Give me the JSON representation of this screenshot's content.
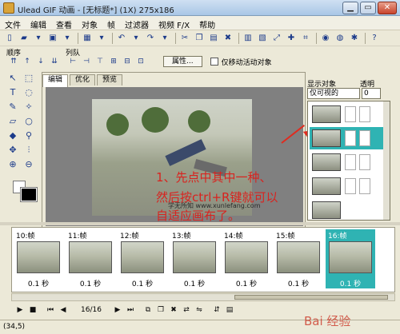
{
  "window": {
    "title": "Ulead GIF 动画 - [无标题*] (1X) 275x186",
    "minimize_label": "▁",
    "maximize_label": "▭",
    "close_label": "✕"
  },
  "menu": [
    "文件",
    "编辑",
    "查看",
    "对象",
    "帧",
    "过滤器",
    "视频 F/X",
    "帮助"
  ],
  "section_labels": {
    "order": "顺序",
    "arrange": "列队"
  },
  "row3": {
    "properties_button": "属性...",
    "checkbox_label": "仅移动活动对象"
  },
  "editor": {
    "tabs": [
      "编辑",
      "优化",
      "预览"
    ],
    "active_tab": 0
  },
  "annotation": {
    "line1": "1、先点中其中一种、",
    "line2": "然后按ctrl+R键就可以",
    "line3": "自适应画布了。",
    "site": "学无所知 www.xunlefang.com"
  },
  "object_panel": {
    "display_label": "显示对象",
    "opacity_label": "透明",
    "display_value": "仅可视的",
    "opacity_value": "0",
    "selected_index": 1
  },
  "frames": [
    {
      "label": "10:帧",
      "delay": "0.1 秒"
    },
    {
      "label": "11:帧",
      "delay": "0.1 秒"
    },
    {
      "label": "12:帧",
      "delay": "0.1 秒"
    },
    {
      "label": "13:帧",
      "delay": "0.1 秒"
    },
    {
      "label": "14:帧",
      "delay": "0.1 秒"
    },
    {
      "label": "15:帧",
      "delay": "0.1 秒"
    },
    {
      "label": "16:帧",
      "delay": "0.1 秒"
    }
  ],
  "selected_frame": 6,
  "playback": {
    "counter": "16/16"
  },
  "status": {
    "coords": "(34,5)"
  },
  "watermark": "Bai 经验",
  "colors": {
    "accent": "#2fb3b3",
    "annotation": "#d8231f"
  }
}
